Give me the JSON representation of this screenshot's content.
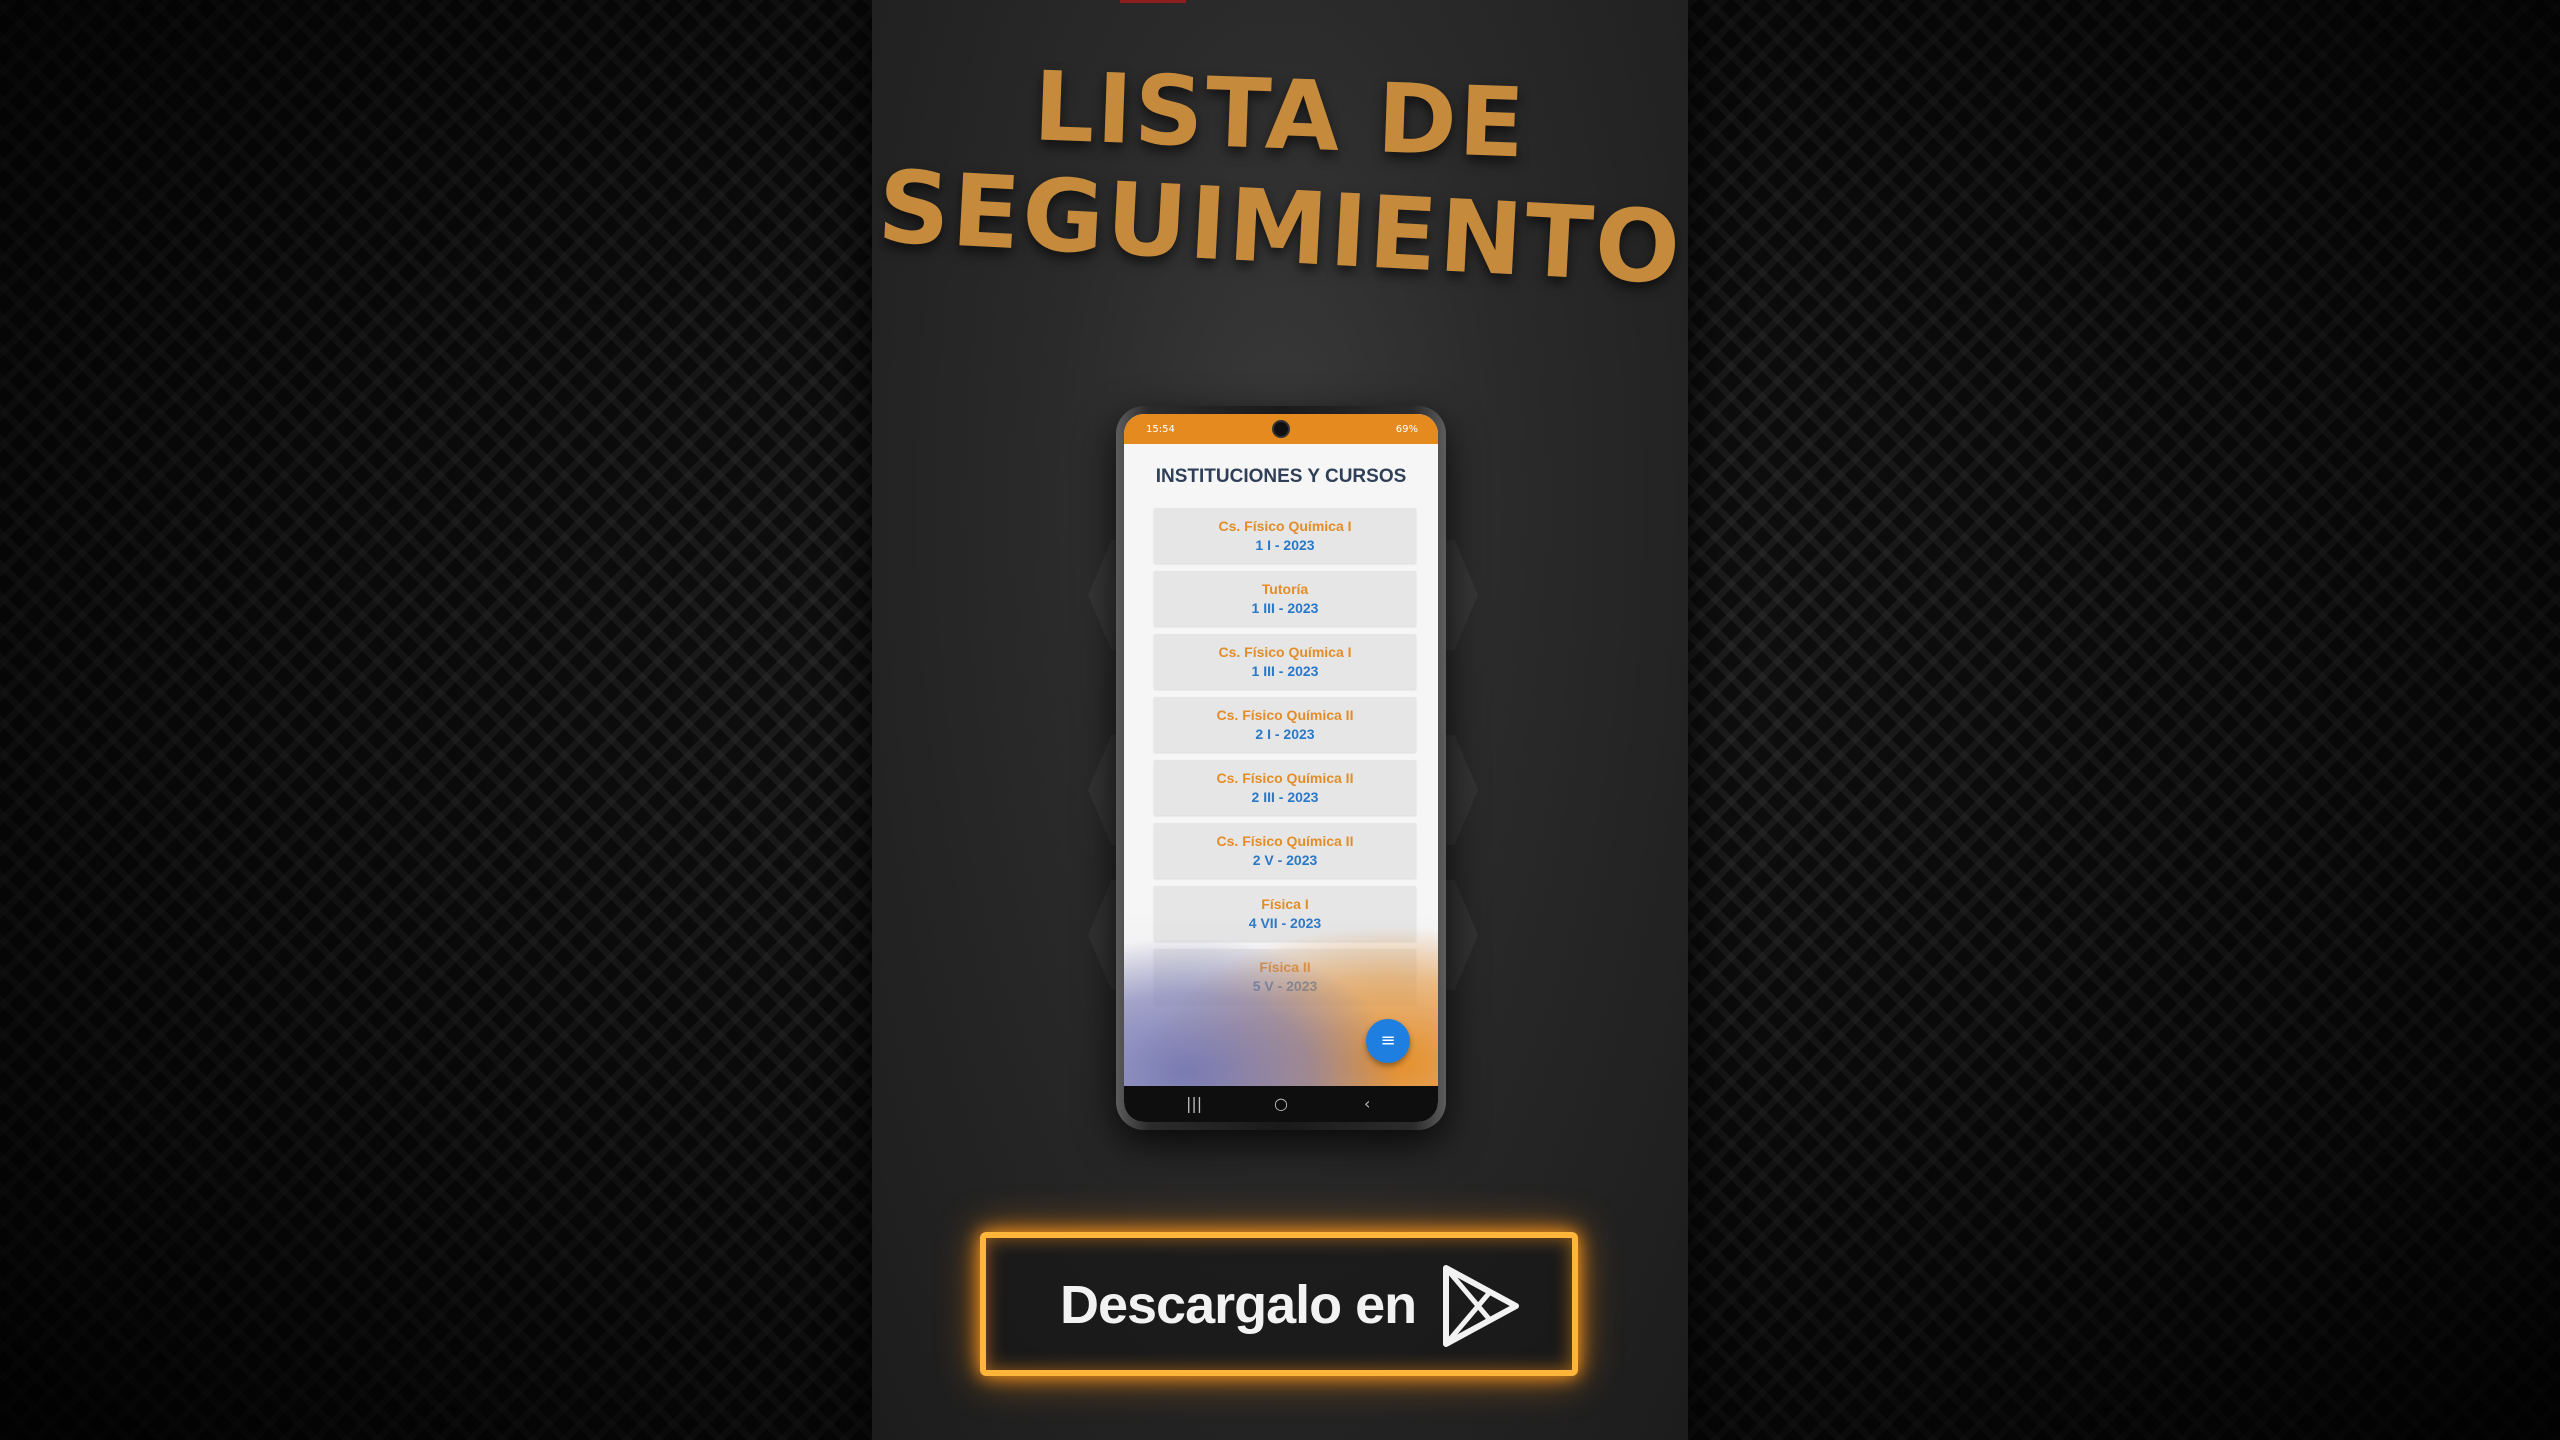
{
  "title": {
    "line1": "LISTA DE",
    "line2": "SEGUIMIENTO"
  },
  "phone": {
    "status_time": "15:54",
    "status_icons_text": "69%",
    "app_title": "INSTITUCIONES Y CURSOS",
    "courses": [
      {
        "name": "Cs. Físico Química I",
        "group": "1 I - 2023"
      },
      {
        "name": "Tutoría",
        "group": "1 III - 2023"
      },
      {
        "name": "Cs. Físico Química I",
        "group": "1 III - 2023"
      },
      {
        "name": "Cs. Físico Química II",
        "group": "2 I - 2023"
      },
      {
        "name": "Cs. Físico Química II",
        "group": "2 III - 2023"
      },
      {
        "name": "Cs. Físico Química II",
        "group": "2 V - 2023"
      },
      {
        "name": "Física I",
        "group": "4 VII - 2023"
      },
      {
        "name": "Física II",
        "group": "5 V - 2023"
      }
    ],
    "fab_icon": "menu-icon",
    "nav": {
      "recents_icon": "recents-icon",
      "home_icon": "home-icon",
      "back_icon": "back-icon"
    }
  },
  "download": {
    "label": "Descargalo en",
    "icon": "google-play-icon"
  },
  "colors": {
    "title": "#c58a3c",
    "status_bar": "#e58a1f",
    "course_name": "#e38d28",
    "course_group": "#2a78c8",
    "fab": "#1e7fe0",
    "button_glow": "#ff9a1f"
  }
}
